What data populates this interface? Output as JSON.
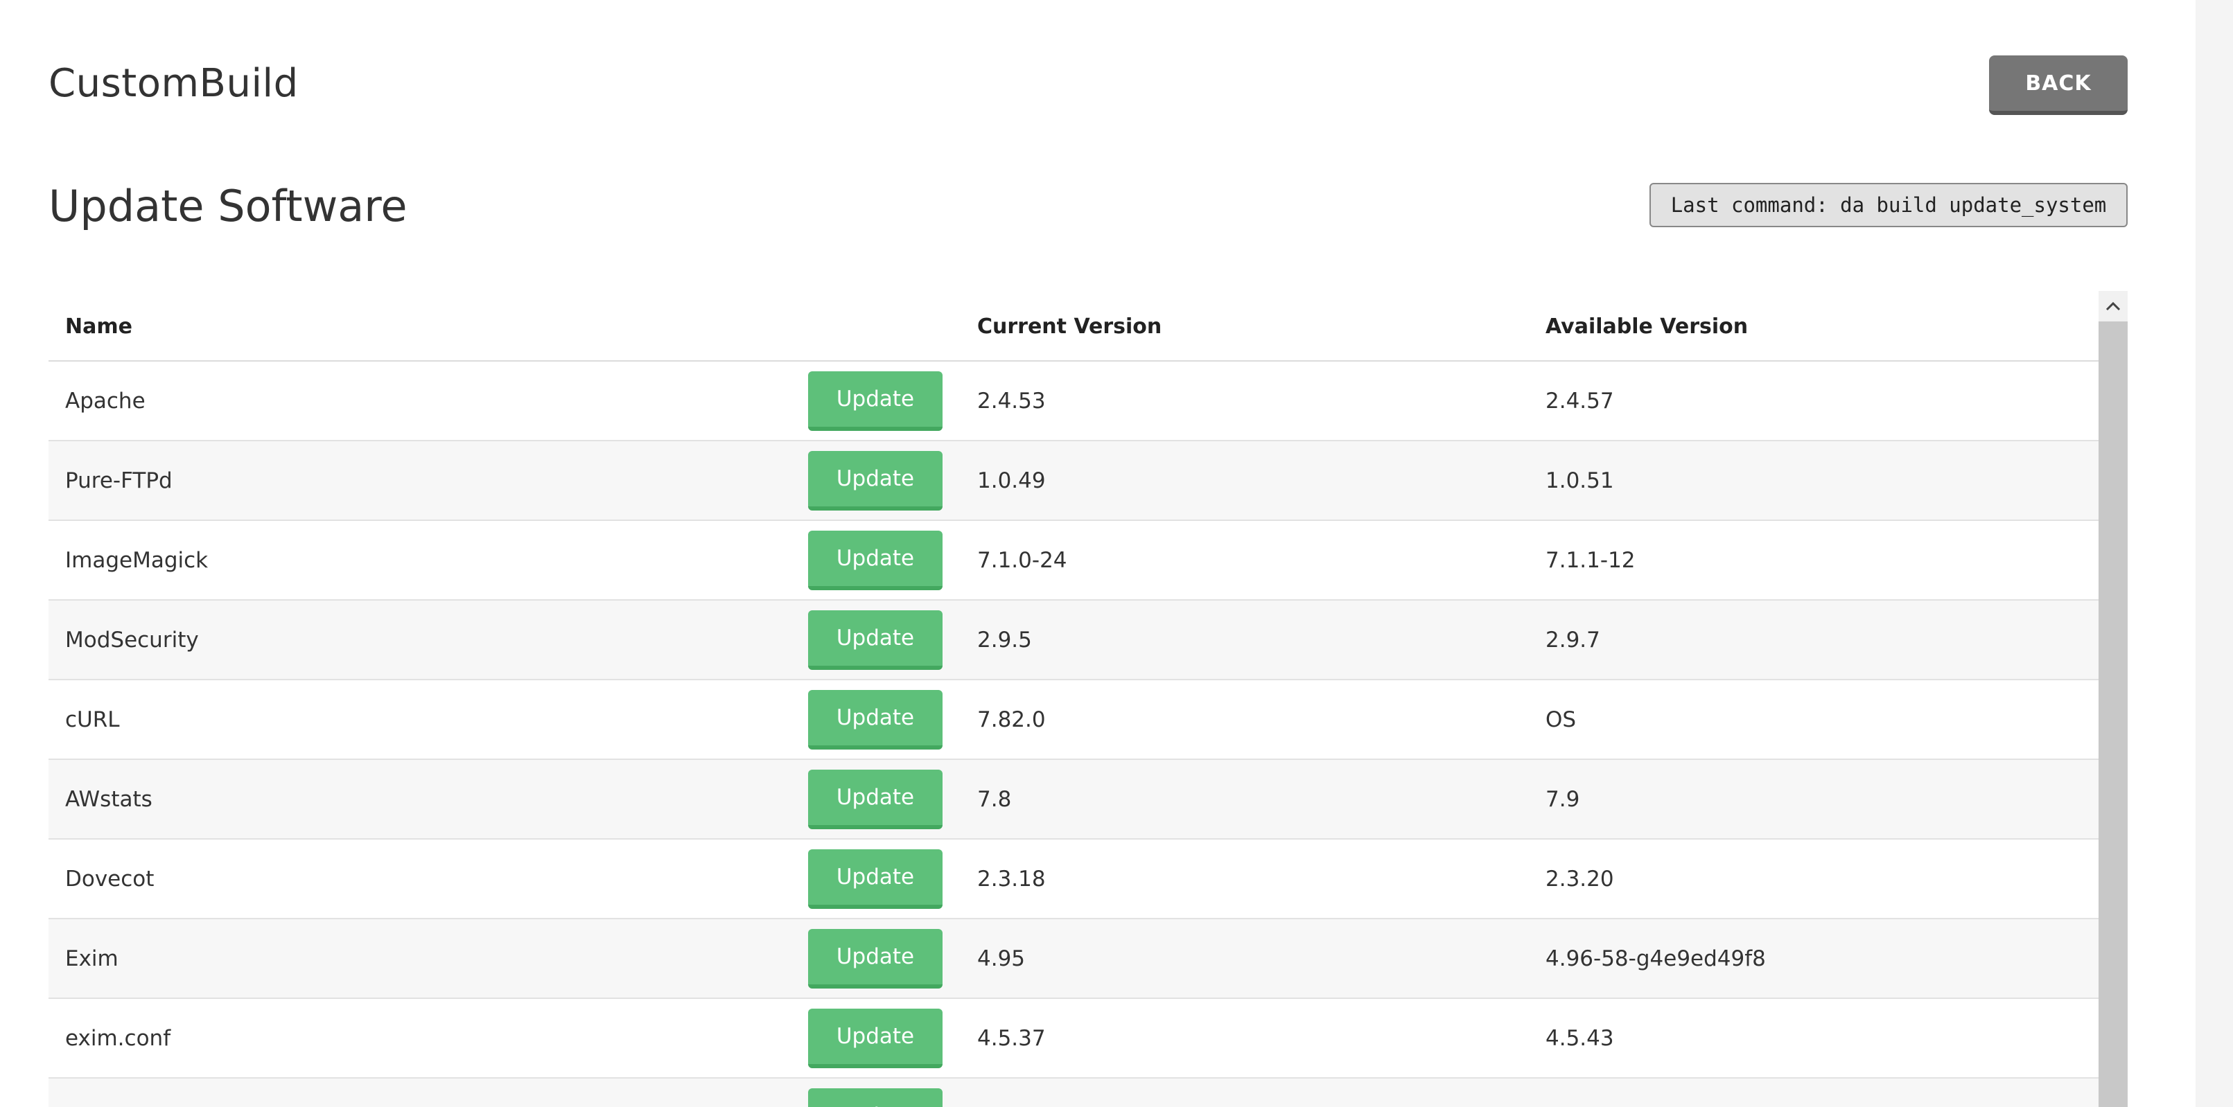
{
  "header": {
    "app_title": "CustomBuild",
    "back_label": "BACK"
  },
  "section": {
    "title": "Update Software",
    "last_command": "Last command: da build update_system"
  },
  "table": {
    "columns": {
      "name": "Name",
      "current": "Current Version",
      "available": "Available Version"
    },
    "update_label": "Update",
    "rows": [
      {
        "name": "Apache",
        "current": "2.4.53",
        "available": "2.4.57"
      },
      {
        "name": "Pure-FTPd",
        "current": "1.0.49",
        "available": "1.0.51"
      },
      {
        "name": "ImageMagick",
        "current": "7.1.0-24",
        "available": "7.1.1-12"
      },
      {
        "name": "ModSecurity",
        "current": "2.9.5",
        "available": "2.9.7"
      },
      {
        "name": "cURL",
        "current": "7.82.0",
        "available": "OS"
      },
      {
        "name": "AWstats",
        "current": "7.8",
        "available": "7.9"
      },
      {
        "name": "Dovecot",
        "current": "2.3.18",
        "available": "2.3.20"
      },
      {
        "name": "Exim",
        "current": "4.95",
        "available": "4.96-58-g4e9ed49f8"
      },
      {
        "name": "exim.conf",
        "current": "4.5.37",
        "available": "4.5.43"
      },
      {
        "name": "",
        "current": "",
        "available": ""
      }
    ]
  },
  "scrollbar": {
    "up_icon": "chevron-up-icon"
  },
  "colors": {
    "update_button": "#5ec07a",
    "back_button": "#767676",
    "row_alt": "#f7f7f7"
  }
}
